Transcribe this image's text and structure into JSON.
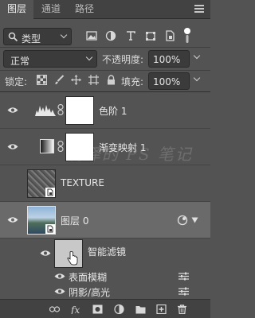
{
  "tabs": [
    {
      "label": "图层"
    },
    {
      "label": "通道"
    },
    {
      "label": "路径"
    }
  ],
  "filter": {
    "kind_label": "类型"
  },
  "blend": {
    "mode": "正常",
    "opacity_label": "不透明度:",
    "opacity_value": "100%"
  },
  "lock": {
    "label": "锁定:",
    "fill_label": "填充:",
    "fill_value": "100%"
  },
  "layers": [
    {
      "name": "色阶 1",
      "type": "adjustment"
    },
    {
      "name": "渐变映射 1",
      "type": "adjustment"
    },
    {
      "name": "TEXTURE",
      "type": "smart-object"
    },
    {
      "name": "图层 0",
      "type": "smart-object"
    }
  ],
  "smart_filters": {
    "label": "智能滤镜",
    "items": [
      {
        "name": "表面模糊"
      },
      {
        "name": "阴影/高光"
      }
    ]
  },
  "watermark": "润泽的 PS 笔记",
  "colors": {
    "panel": "#535353",
    "tab_bar": "#424242",
    "selected_row": "#6a6a6a"
  }
}
